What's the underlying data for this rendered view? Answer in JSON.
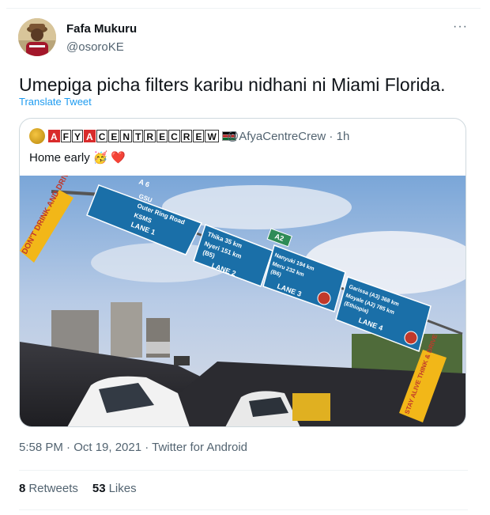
{
  "author": {
    "name": "Fafa Mukuru",
    "handle": "@osoroKE"
  },
  "tweet": {
    "text": "Umepiga picha filters karibu nidhani ni Miami Florida.",
    "translate_label": "Translate Tweet",
    "more_label": "···"
  },
  "quoted_tweet": {
    "display_name_letters": [
      "A",
      "F",
      "Y",
      "A",
      "C",
      "E",
      "N",
      "T",
      "R",
      "E",
      "C",
      "R",
      "E",
      "W"
    ],
    "handle_time": "@AfyaCentreCrew · 1h",
    "text": "Home early",
    "emojis": [
      "🥳",
      "❤️"
    ],
    "image": {
      "signs": {
        "sign1": [
          "GSU",
          "Outer Ring Road",
          "KSMS",
          "LANE 1"
        ],
        "sign1_tab": "A 6",
        "sign2": [
          "Thika 35 km",
          "Nyeri 151 km",
          "(B5)",
          "LANE 2"
        ],
        "sign2_tab": "A2",
        "sign3": [
          "Nanyuki 194 km",
          "Meru 232 km",
          "(B6)",
          "LANE 3"
        ],
        "sign4": [
          "Garissa (A3) 368 km",
          "Moyale (A2) 785 km",
          "(Ethiopia)",
          "LANE 4"
        ],
        "left_banner": "DON'T DRINK AND DRIVE",
        "right_banner": "STAY ALIVE THINK & DRIVE"
      }
    }
  },
  "meta": {
    "timestamp": "5:58 PM · Oct 19, 2021 · Twitter for Android"
  },
  "stats": {
    "retweets_count": "8",
    "retweets_label": "Retweets",
    "likes_count": "53",
    "likes_label": "Likes"
  },
  "colors": {
    "link": "#1d9bf0",
    "sign_blue": "#1a6fa8",
    "sign_green": "#2e8b57",
    "banner_yellow": "#f2b718"
  }
}
